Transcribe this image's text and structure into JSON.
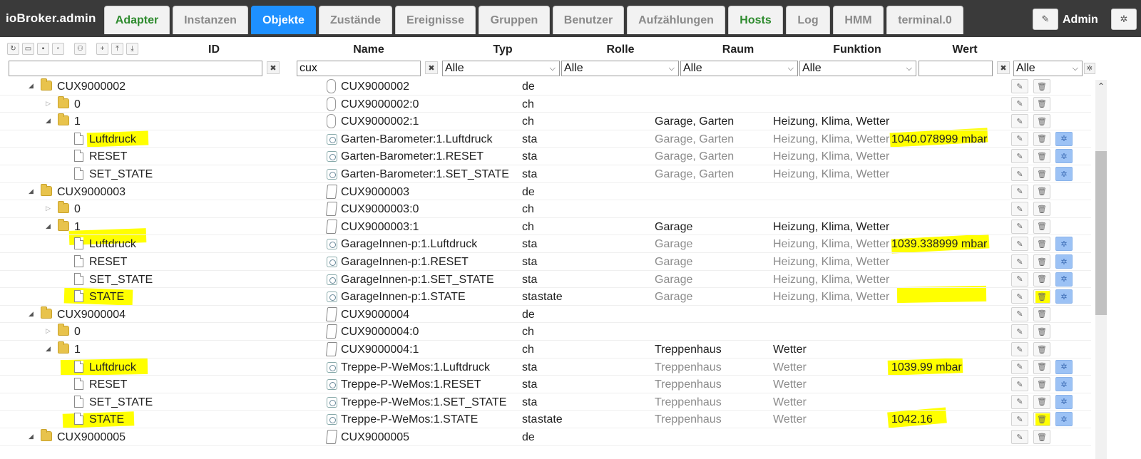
{
  "app": {
    "title": "ioBroker.admin"
  },
  "tabs": [
    {
      "label": "Adapter"
    },
    {
      "label": "Instanzen"
    },
    {
      "label": "Objekte"
    },
    {
      "label": "Zustände"
    },
    {
      "label": "Ereignisse"
    },
    {
      "label": "Gruppen"
    },
    {
      "label": "Benutzer"
    },
    {
      "label": "Aufzählungen"
    },
    {
      "label": "Hosts"
    },
    {
      "label": "Log"
    },
    {
      "label": "HMM"
    },
    {
      "label": "terminal.0"
    }
  ],
  "user": {
    "name": "Admin"
  },
  "columns": {
    "id": "ID",
    "name": "Name",
    "type": "Typ",
    "role": "Rolle",
    "room": "Raum",
    "function": "Funktion",
    "value": "Wert"
  },
  "filters": {
    "id": "",
    "name": "cux",
    "type": "Alle",
    "role": "Alle",
    "room": "Alle",
    "function": "Alle",
    "value": "",
    "extra": "Alle"
  },
  "rows": [
    {
      "id": "CUX9000002",
      "name": "CUX9000002",
      "type": "de",
      "role": "",
      "room": "",
      "func": "",
      "value": ""
    },
    {
      "id": "0",
      "name": "CUX9000002:0",
      "type": "ch",
      "role": "",
      "room": "",
      "func": "",
      "value": ""
    },
    {
      "id": "1",
      "name": "CUX9000002:1",
      "type": "ch",
      "role": "",
      "room": "Garage, Garten",
      "func": "Heizung, Klima, Wetter",
      "value": ""
    },
    {
      "id": "Luftdruck",
      "name": "Garten-Barometer:1.Luftdruck",
      "type": "sta",
      "role": "",
      "room": "Garage, Garten",
      "func": "Heizung, Klima, Wetter",
      "value": "1040.078999 mbar"
    },
    {
      "id": "RESET",
      "name": "Garten-Barometer:1.RESET",
      "type": "sta",
      "role": "",
      "room": "Garage, Garten",
      "func": "Heizung, Klima, Wetter",
      "value": ""
    },
    {
      "id": "SET_STATE",
      "name": "Garten-Barometer:1.SET_STATE",
      "type": "sta",
      "role": "",
      "room": "Garage, Garten",
      "func": "Heizung, Klima, Wetter",
      "value": ""
    },
    {
      "id": "CUX9000003",
      "name": "CUX9000003",
      "type": "de",
      "role": "",
      "room": "",
      "func": "",
      "value": ""
    },
    {
      "id": "0",
      "name": "CUX9000003:0",
      "type": "ch",
      "role": "",
      "room": "",
      "func": "",
      "value": ""
    },
    {
      "id": "1",
      "name": "CUX9000003:1",
      "type": "ch",
      "role": "",
      "room": "Garage",
      "func": "Heizung, Klima, Wetter",
      "value": ""
    },
    {
      "id": "Luftdruck",
      "name": "GarageInnen-p:1.Luftdruck",
      "type": "sta",
      "role": "",
      "room": "Garage",
      "func": "Heizung, Klima, Wetter",
      "value": "1039.338999 mbar"
    },
    {
      "id": "RESET",
      "name": "GarageInnen-p:1.RESET",
      "type": "sta",
      "role": "",
      "room": "Garage",
      "func": "Heizung, Klima, Wetter",
      "value": ""
    },
    {
      "id": "SET_STATE",
      "name": "GarageInnen-p:1.SET_STATE",
      "type": "sta",
      "role": "",
      "room": "Garage",
      "func": "Heizung, Klima, Wetter",
      "value": ""
    },
    {
      "id": "STATE",
      "name": "GarageInnen-p:1.STATE",
      "type": "sta",
      "role": "state",
      "room": "Garage",
      "func": "Heizung, Klima, Wetter",
      "value": ""
    },
    {
      "id": "CUX9000004",
      "name": "CUX9000004",
      "type": "de",
      "role": "",
      "room": "",
      "func": "",
      "value": ""
    },
    {
      "id": "0",
      "name": "CUX9000004:0",
      "type": "ch",
      "role": "",
      "room": "",
      "func": "",
      "value": ""
    },
    {
      "id": "1",
      "name": "CUX9000004:1",
      "type": "ch",
      "role": "",
      "room": "Treppenhaus",
      "func": "Wetter",
      "value": ""
    },
    {
      "id": "Luftdruck",
      "name": "Treppe-P-WeMos:1.Luftdruck",
      "type": "sta",
      "role": "",
      "room": "Treppenhaus",
      "func": "Wetter",
      "value": "1039.99 mbar"
    },
    {
      "id": "RESET",
      "name": "Treppe-P-WeMos:1.RESET",
      "type": "sta",
      "role": "",
      "room": "Treppenhaus",
      "func": "Wetter",
      "value": ""
    },
    {
      "id": "SET_STATE",
      "name": "Treppe-P-WeMos:1.SET_STATE",
      "type": "sta",
      "role": "",
      "room": "Treppenhaus",
      "func": "Wetter",
      "value": ""
    },
    {
      "id": "STATE",
      "name": "Treppe-P-WeMos:1.STATE",
      "type": "sta",
      "role": "state",
      "room": "Treppenhaus",
      "func": "Wetter",
      "value": "1042.16"
    },
    {
      "id": "CUX9000005",
      "name": "CUX9000005",
      "type": "de",
      "role": "",
      "room": "",
      "func": "",
      "value": ""
    }
  ]
}
